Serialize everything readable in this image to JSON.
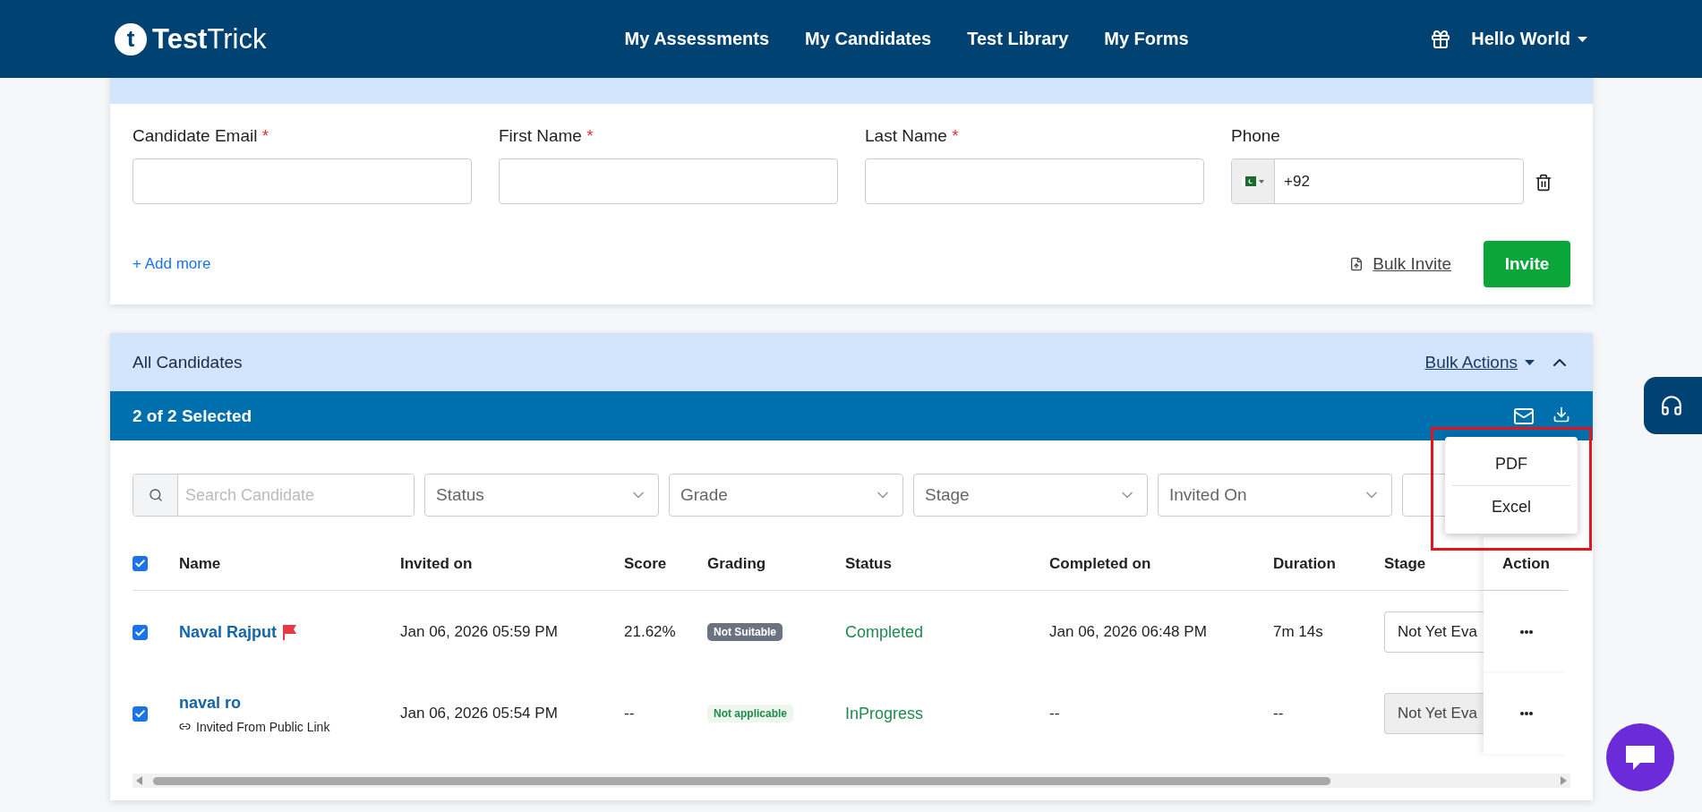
{
  "nav": {
    "logo_mark": "t",
    "brand": "**Test**Trick",
    "links": [
      "My Assessments",
      "My Candidates",
      "Test Library",
      "My Forms"
    ],
    "user": "Hello World"
  },
  "invite": {
    "required_mark": "*",
    "fields": [
      {
        "label": "Candidate Email",
        "required": true
      },
      {
        "label": "First Name",
        "required": true
      },
      {
        "label": "Last Name",
        "required": true
      }
    ],
    "phone": {
      "label": "Phone",
      "code": "+92"
    },
    "add_more": "+ Add more",
    "bulk_invite": "Bulk Invite",
    "invite_button": "Invite"
  },
  "candidates": {
    "title": "All Candidates",
    "bulk_actions": "Bulk Actions",
    "selection": "2 of 2 Selected",
    "export_menu": [
      "PDF",
      "Excel"
    ],
    "search": {
      "placeholder": "Search Candidate"
    },
    "filters": [
      "Status",
      "Grade",
      "Stage",
      "Invited On"
    ],
    "all_checked": true,
    "columns": [
      "Name",
      "Invited on",
      "Score",
      "Grading",
      "Status",
      "Completed on",
      "Duration",
      "Stage",
      "Action"
    ],
    "rows": [
      {
        "name": "Naval Rajput",
        "flagged": true,
        "checked": true,
        "invited_on": "Jan 06, 2026 05:59 PM",
        "score": "21.62%",
        "grading": {
          "label": "Not Suitable",
          "kind": "not_suitable"
        },
        "status": "Completed",
        "completed_on": "Jan 06, 2026 06:48 PM",
        "duration": "7m 14s",
        "stage": "Not Yet Eva",
        "stage_disabled": false
      },
      {
        "name": "naval ro",
        "flagged": false,
        "checked": true,
        "subtitle": "Invited From Public Link",
        "invited_on": "Jan 06, 2026 05:54 PM",
        "score": "--",
        "grading": {
          "label": "Not applicable",
          "kind": "not_applicable"
        },
        "status": "InProgress",
        "completed_on": "--",
        "duration": "--",
        "stage": "Not Yet Eva",
        "stage_disabled": true
      }
    ]
  }
}
